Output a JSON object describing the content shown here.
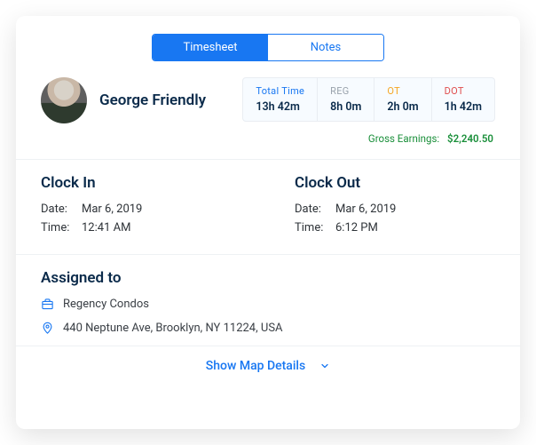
{
  "tabs": {
    "timesheet": "Timesheet",
    "notes": "Notes"
  },
  "employee": {
    "name": "George Friendly"
  },
  "stats": {
    "total": {
      "label": "Total Time",
      "value": "13h 42m"
    },
    "reg": {
      "label": "REG",
      "value": "8h 0m"
    },
    "ot": {
      "label": "OT",
      "value": "2h 0m"
    },
    "dot": {
      "label": "DOT",
      "value": "1h 42m"
    }
  },
  "earnings": {
    "label": "Gross Earnings:",
    "value": "$2,240.50"
  },
  "clockIn": {
    "title": "Clock In",
    "dateLabel": "Date:",
    "date": "Mar 6, 2019",
    "timeLabel": "Time:",
    "time": "12:41 AM"
  },
  "clockOut": {
    "title": "Clock Out",
    "dateLabel": "Date:",
    "date": "Mar 6, 2019",
    "timeLabel": "Time:",
    "time": "6:12 PM"
  },
  "assigned": {
    "title": "Assigned to",
    "project": "Regency Condos",
    "address": "440 Neptune Ave, Brooklyn, NY 11224, USA"
  },
  "showMap": "Show Map Details"
}
